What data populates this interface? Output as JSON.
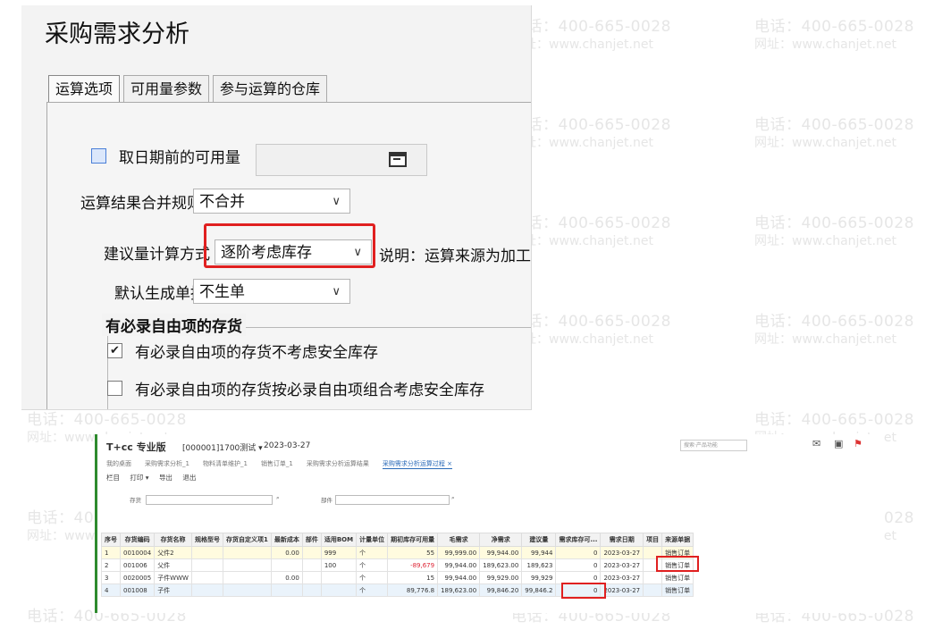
{
  "watermark": {
    "phone": "电话：400-665-0028",
    "site": "网址：www.chanjet.net"
  },
  "dialog": {
    "title": "采购需求分析",
    "tabs": [
      {
        "label": "运算选项",
        "active": true
      },
      {
        "label": "可用量参数",
        "active": false
      },
      {
        "label": "参与运算的仓库",
        "active": false
      }
    ],
    "prior_available": {
      "label": "取日期前的可用量",
      "checked": false,
      "date_value": ""
    },
    "merge_rule": {
      "label": "运算结果合并规则",
      "value": "不合并"
    },
    "calc_method": {
      "label": "建议量计算方式",
      "value": "逐阶考虑库存"
    },
    "note": "说明：运算来源为加工",
    "default_doc": {
      "label": "默认生成单据",
      "value": "不生单"
    },
    "free_item_group": {
      "title": "有必录自由项的存货",
      "options": [
        {
          "label": "有必录自由项的存货不考虑安全库存",
          "checked": true
        },
        {
          "label": "有必录自由项的存货按必录自由项组合考虑安全库存",
          "checked": false
        }
      ]
    }
  },
  "app": {
    "brand": "T+cc 专业版",
    "account": "[000001]1700测试 ▾",
    "date": "2023-03-27",
    "search_placeholder": "搜索·产品功能",
    "tabs": [
      {
        "label": "我的桌面",
        "active": false
      },
      {
        "label": "采购需求分析_1",
        "active": false
      },
      {
        "label": "物料清单维护_1",
        "active": false
      },
      {
        "label": "销售订单_1",
        "active": false
      },
      {
        "label": "采购需求分析运算结果",
        "active": false
      },
      {
        "label": "采购需求分析运算过程 ×",
        "active": true
      }
    ],
    "menu": [
      "栏目",
      "打印 ▾",
      "导出",
      "退出"
    ],
    "filters": {
      "stock_label": "存货",
      "part_label": "部件"
    },
    "columns": [
      "序号",
      "存货编码",
      "存货名称",
      "规格型号",
      "存货自定义项1",
      "最新成本",
      "部件",
      "适用BOM",
      "计量单位",
      "期初库存可用量",
      "毛需求",
      "净需求",
      "建议量",
      "需求库存可...",
      "需求日期",
      "项目",
      "来源单据"
    ],
    "rows": [
      [
        "1",
        "0010004",
        "父件2",
        "",
        "",
        "0.00",
        "",
        "999",
        "个",
        "55",
        "99,999.00",
        "99,944.00",
        "99,944",
        "0",
        "2023-03-27",
        "",
        "销售订单"
      ],
      [
        "2",
        "001006",
        "父件",
        "",
        "",
        "",
        "",
        "100",
        "个",
        "-89,679",
        "99,944.00",
        "189,623.00",
        "189,623",
        "0",
        "2023-03-27",
        "",
        "销售订单"
      ],
      [
        "3",
        "0020005",
        "子件WWW",
        "",
        "",
        "0.00",
        "",
        "",
        "个",
        "15",
        "99,944.00",
        "99,929.00",
        "99,929",
        "0",
        "2023-03-27",
        "",
        "销售订单"
      ],
      [
        "4",
        "001008",
        "子件",
        "",
        "",
        "",
        "",
        "",
        "个",
        "89,776.8",
        "189,623.00",
        "99,846.20",
        "99,846.2",
        "0",
        "2023-03-27",
        "",
        "销售订单"
      ]
    ]
  }
}
